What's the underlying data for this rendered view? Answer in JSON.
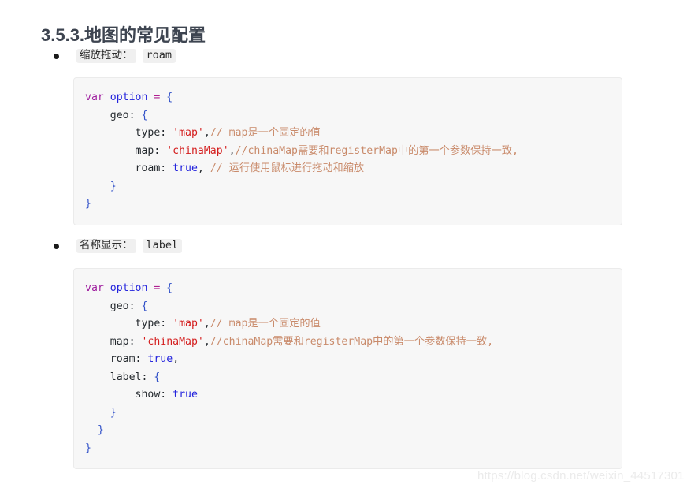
{
  "heading": "3.5.3.地图的常见配置",
  "bullets": [
    {
      "label": "缩放拖动：",
      "code": "roam"
    },
    {
      "label": "名称显示：",
      "code": "label"
    }
  ],
  "code_blocks": [
    {
      "name": "roam-example",
      "lines": [
        [
          {
            "t": "var ",
            "c": "t-kw"
          },
          {
            "t": "option",
            "c": "t-var"
          },
          {
            "t": " = ",
            "c": "t-op"
          },
          {
            "t": "{",
            "c": "t-brace"
          }
        ],
        [
          {
            "t": "    geo",
            "c": "t-prop"
          },
          {
            "t": ": ",
            "c": "t-punc"
          },
          {
            "t": "{",
            "c": "t-brace"
          }
        ],
        [
          {
            "t": "        type",
            "c": "t-prop"
          },
          {
            "t": ": ",
            "c": "t-punc"
          },
          {
            "t": "'map'",
            "c": "t-str"
          },
          {
            "t": ",",
            "c": "t-punc"
          },
          {
            "t": "// map是一个固定的值",
            "c": "t-cmt"
          }
        ],
        [
          {
            "t": "        map",
            "c": "t-prop"
          },
          {
            "t": ": ",
            "c": "t-punc"
          },
          {
            "t": "'chinaMap'",
            "c": "t-str"
          },
          {
            "t": ",",
            "c": "t-punc"
          },
          {
            "t": "//chinaMap需要和registerMap中的第一个参数保持一致,",
            "c": "t-cmt"
          }
        ],
        [
          {
            "t": "        roam",
            "c": "t-prop"
          },
          {
            "t": ": ",
            "c": "t-punc"
          },
          {
            "t": "true",
            "c": "t-bool"
          },
          {
            "t": ", ",
            "c": "t-punc"
          },
          {
            "t": "// 运行使用鼠标进行拖动和缩放",
            "c": "t-cmt"
          }
        ],
        [
          {
            "t": "    }",
            "c": "t-brace"
          }
        ],
        [
          {
            "t": "}",
            "c": "t-brace"
          }
        ]
      ]
    },
    {
      "name": "label-example",
      "lines": [
        [
          {
            "t": "var ",
            "c": "t-kw"
          },
          {
            "t": "option",
            "c": "t-var"
          },
          {
            "t": " = ",
            "c": "t-op"
          },
          {
            "t": "{",
            "c": "t-brace"
          }
        ],
        [
          {
            "t": "    geo",
            "c": "t-prop"
          },
          {
            "t": ": ",
            "c": "t-punc"
          },
          {
            "t": "{",
            "c": "t-brace"
          }
        ],
        [
          {
            "t": "        type",
            "c": "t-prop"
          },
          {
            "t": ": ",
            "c": "t-punc"
          },
          {
            "t": "'map'",
            "c": "t-str"
          },
          {
            "t": ",",
            "c": "t-punc"
          },
          {
            "t": "// map是一个固定的值",
            "c": "t-cmt"
          }
        ],
        [
          {
            "t": "    map",
            "c": "t-prop"
          },
          {
            "t": ": ",
            "c": "t-punc"
          },
          {
            "t": "'chinaMap'",
            "c": "t-str"
          },
          {
            "t": ",",
            "c": "t-punc"
          },
          {
            "t": "//chinaMap需要和registerMap中的第一个参数保持一致,",
            "c": "t-cmt"
          }
        ],
        [
          {
            "t": "    roam",
            "c": "t-prop"
          },
          {
            "t": ": ",
            "c": "t-punc"
          },
          {
            "t": "true",
            "c": "t-bool"
          },
          {
            "t": ",",
            "c": "t-punc"
          }
        ],
        [
          {
            "t": "    label",
            "c": "t-prop"
          },
          {
            "t": ": ",
            "c": "t-punc"
          },
          {
            "t": "{",
            "c": "t-brace"
          }
        ],
        [
          {
            "t": "        show",
            "c": "t-prop"
          },
          {
            "t": ": ",
            "c": "t-punc"
          },
          {
            "t": "true",
            "c": "t-bool"
          }
        ],
        [
          {
            "t": "    }",
            "c": "t-brace"
          }
        ],
        [
          {
            "t": "  }",
            "c": "t-brace"
          }
        ],
        [
          {
            "t": "}",
            "c": "t-brace"
          }
        ]
      ]
    }
  ],
  "watermark": "https://blog.csdn.net/weixin_44517301"
}
